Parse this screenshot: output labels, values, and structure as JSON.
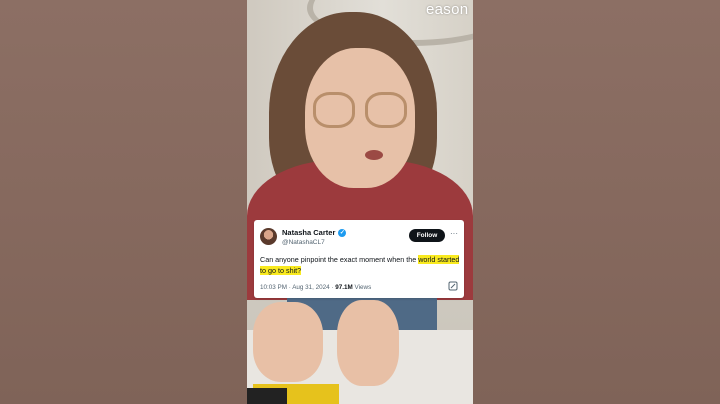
{
  "watermark": {
    "text": "eason"
  },
  "tweet": {
    "display_name": "Natasha Carter",
    "handle": "@NatashaCL7",
    "verified_glyph": "✓",
    "follow_label": "Follow",
    "more_glyph": "···",
    "text_plain": "Can anyone pinpoint the exact moment when the",
    "text_highlight": "world started to go to shit?",
    "highlight_color": "#f9ea1f",
    "meta_prefix": "10:03 PM · Aug 31, 2024 · ",
    "views_number": "97.1M",
    "views_label": " Views",
    "action_icon": "grok-icon"
  },
  "colors": {
    "background": "#8a6d63",
    "follow_button": "#0f1419",
    "verified": "#1d9bf0"
  }
}
